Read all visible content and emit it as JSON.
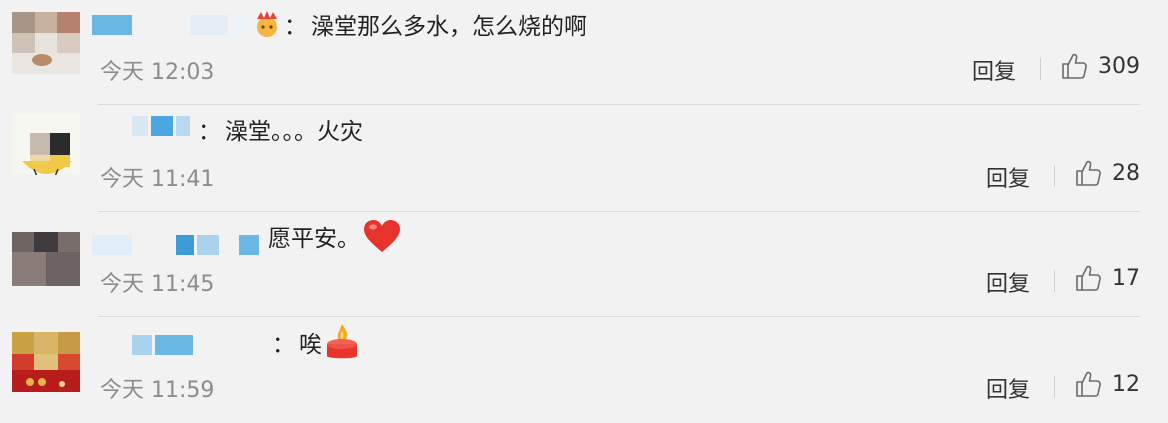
{
  "comments": [
    {
      "separator": "：",
      "text": "澡堂那么多水，怎么烧的啊",
      "time": "今天 12:03",
      "reply_label": "回复",
      "likes": "309",
      "emoji": "crown-face-emoji"
    },
    {
      "separator": "：",
      "text": "澡堂。。。火灾",
      "time": "今天 11:41",
      "reply_label": "回复",
      "likes": "28"
    },
    {
      "text": "愿平安。",
      "time": "今天 11:45",
      "reply_label": "回复",
      "likes": "17",
      "emoji": "red-heart-emoji"
    },
    {
      "separator": "：",
      "text": "唉",
      "time": "今天 11:59",
      "reply_label": "回复",
      "likes": "12",
      "emoji": "candle-emoji"
    }
  ],
  "colors": {
    "background": "#f2f2f2",
    "username_blur": "#6ab7e6",
    "time_text": "#8c8c8c",
    "heart": "#e8322d",
    "candle": "#e8342b"
  }
}
